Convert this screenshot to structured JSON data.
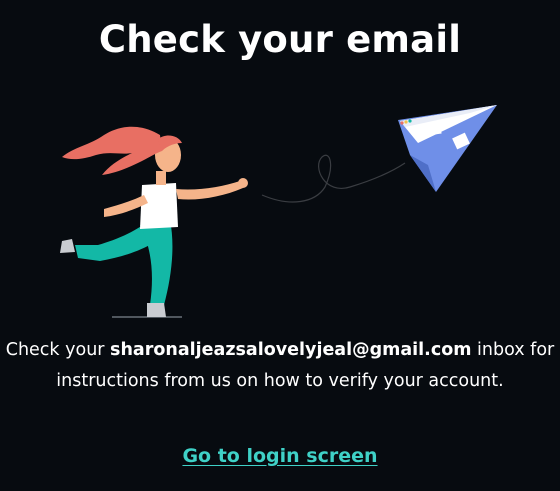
{
  "page": {
    "title": "Check your email"
  },
  "message": {
    "prefix": "Check your ",
    "email": "sharonaljeazsalovelyjeal@gmail.com",
    "line1_suffix": " inbox for",
    "line2": "instructions from us on how to verify your account."
  },
  "actions": {
    "login_link": "Go to login screen"
  },
  "colors": {
    "background": "#070b10",
    "text": "#ffffff",
    "link": "#3fd1c7",
    "hair": "#e86f63",
    "pants": "#13b8a6",
    "plane": "#6f8fe8"
  },
  "illustration": {
    "subject": "woman-throwing-paper-plane",
    "icons": [
      "woman-illustration-icon",
      "paper-plane-icon",
      "flight-path-icon"
    ]
  }
}
